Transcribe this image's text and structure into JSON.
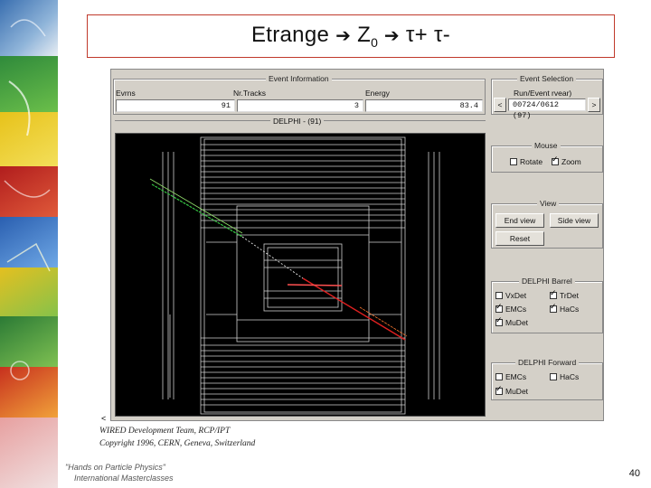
{
  "title": {
    "part1": "Etrange ",
    "arrow": "➔",
    "part2": " Z",
    "sub": "0",
    "part3": " τ+ τ-"
  },
  "event_information": {
    "group_title": "Event Information",
    "labels": [
      "Evrns",
      "Nr.Tracks",
      "Energy"
    ],
    "values": [
      "91",
      "3",
      "83.4"
    ]
  },
  "event_selection": {
    "group_title": "Event Selection",
    "run_label": "Run/Event  rvear)",
    "prev": "<",
    "next": ">",
    "run_value": "00724/0612  (97)"
  },
  "display": {
    "title": "DELPHI - (91)"
  },
  "mouse": {
    "group_title": "Mouse",
    "rotate_label": "Rotate",
    "rotate_checked": false,
    "zoom_label": "Zoom",
    "zoom_checked": true
  },
  "view": {
    "group_title": "View",
    "end_view": "End view",
    "side_view": "Side view",
    "reset": "Reset"
  },
  "barrel": {
    "group_title": "DELPHI Barrel",
    "items": [
      {
        "label": "VxDet",
        "checked": false
      },
      {
        "label": "TrDet",
        "checked": true
      },
      {
        "label": "EMCs",
        "checked": true
      },
      {
        "label": "HaCs",
        "checked": true
      },
      {
        "label": "MuDet",
        "checked": true
      }
    ]
  },
  "forward": {
    "group_title": "DELPHI Forward",
    "items": [
      {
        "label": "EMCs",
        "checked": false
      },
      {
        "label": "HaCs",
        "checked": false
      },
      {
        "label": "MuDet",
        "checked": true
      }
    ]
  },
  "footer": {
    "scroll_marker": "<",
    "dev_team": "WIRED Development Team, RCP/IPT",
    "copyright": "Copyright 1996, CERN, Geneva, Switzerland",
    "logo_line1": "\"Hands on Particle Physics\"",
    "logo_line2": "International Masterclasses"
  },
  "page_number": "40"
}
